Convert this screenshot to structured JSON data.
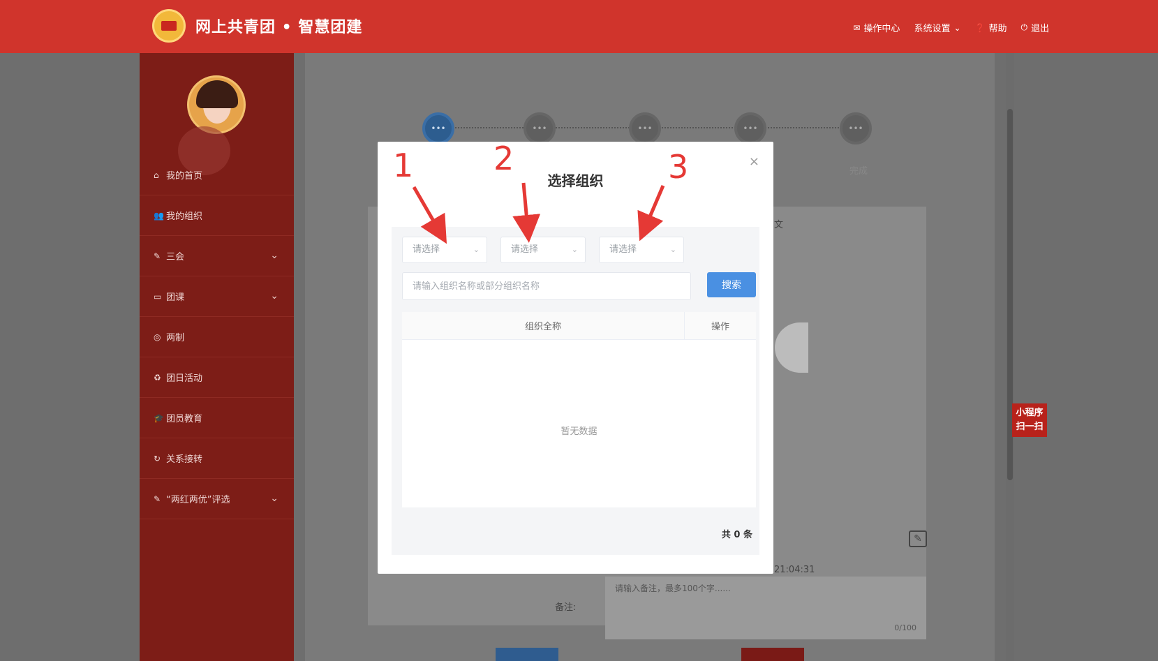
{
  "header": {
    "site_title": "网上共青团 • 智慧团建",
    "nav": [
      {
        "label": "操作中心",
        "icon": "envelope-icon"
      },
      {
        "label": "系统设置",
        "icon": "chevron-down-icon"
      },
      {
        "label": "帮助",
        "icon": "help-icon"
      },
      {
        "label": "退出",
        "icon": "power-icon"
      }
    ]
  },
  "sidebar": {
    "items": [
      {
        "label": "我的首页",
        "icon": "home-icon"
      },
      {
        "label": "我的组织",
        "icon": "users-icon"
      },
      {
        "label": "三会",
        "icon": "edit-icon",
        "expandable": true
      },
      {
        "label": "团课",
        "icon": "folder-icon",
        "expandable": true
      },
      {
        "label": "两制",
        "icon": "target-icon"
      },
      {
        "label": "团日活动",
        "icon": "recycle-icon"
      },
      {
        "label": "团员教育",
        "icon": "graduation-cap-icon"
      },
      {
        "label": "关系接转",
        "icon": "refresh-icon"
      },
      {
        "label": "“两红两优”评选",
        "icon": "edit-icon",
        "expandable": true
      }
    ]
  },
  "background": {
    "step_done_label": "完成",
    "partial_text_1": "文",
    "time_text": "21:04:31",
    "remark_label": "备注:",
    "remark_placeholder": "请输入备注，最多100个字......",
    "remark_count": "0/100"
  },
  "mini_program": {
    "line1": "小程序",
    "line2": "扫一扫"
  },
  "modal": {
    "title": "选择组织",
    "close": "×",
    "selects": [
      {
        "placeholder": "请选择"
      },
      {
        "placeholder": "请选择"
      },
      {
        "placeholder": "请选择"
      }
    ],
    "search_placeholder": "请输入组织名称或部分组织名称",
    "search_button": "搜索",
    "table": {
      "columns": [
        "组织全称",
        "操作"
      ],
      "empty_text": "暂无数据"
    },
    "total": "共 0 条"
  },
  "annotations": {
    "labels": [
      "1",
      "2",
      "3"
    ],
    "color": "#e53935"
  },
  "colors": {
    "header": "#d0342c",
    "sidebar": "#7d1d17",
    "primary": "#4a90e2"
  }
}
